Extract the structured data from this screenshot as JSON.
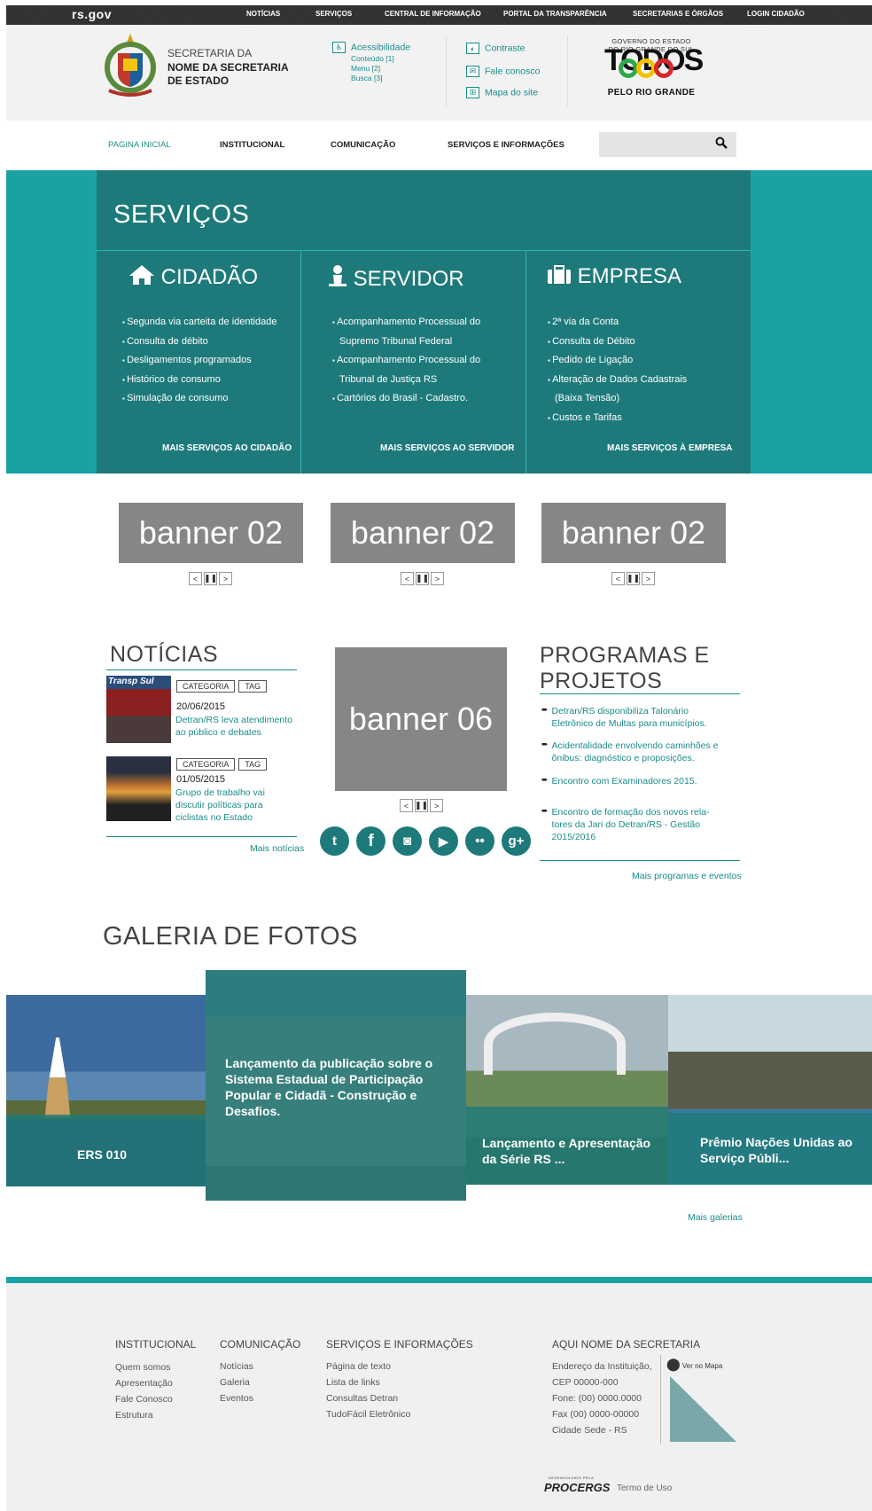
{
  "topbar": {
    "logo": "rs.gov",
    "links": [
      "NOTÍCIAS",
      "SERVIÇOS",
      "CENTRAL DE INFORMAÇÃO",
      "PORTAL DA TRANSPARÊNCIA",
      "SECRETARIAS E ÓRGÃOS",
      "LOGIN CIDADÃO"
    ]
  },
  "header": {
    "org_line1": "SECRETARIA DA",
    "org_line2": "NOME DA SECRETARIA",
    "org_line3": "DE ESTADO",
    "accessibility": "Acessibilidade",
    "shortcuts": [
      "Conteúdo [1]",
      "Menu [2]",
      "Busca [3]"
    ],
    "contrast": "Contraste",
    "contact": "Fale conosco",
    "sitemap": "Mapa do site",
    "gov_line1": "GOVERNO DO ESTADO",
    "gov_line2": "DO RIO GRANDE DO SUL",
    "todos": "TODOS",
    "todos_sub": "PELO RIO GRANDE"
  },
  "nav": {
    "items": [
      "PAGINA INICIAL",
      "INSTITUCIONAL",
      "COMUNICAÇÃO",
      "SERVIÇOS E INFORMAÇÕES"
    ],
    "search_placeholder": ""
  },
  "services": {
    "title": "SERVIÇOS",
    "cidadao": {
      "title": "CIDADÃO",
      "items": [
        "Segunda via carteita de identidade",
        "Consulta de débito",
        "Desligamentos programados",
        "Histórico de consumo",
        "Simulação de consumo"
      ],
      "more": "MAIS SERVIÇOS AO CIDADÃO"
    },
    "servidor": {
      "title": "SERVIDOR",
      "items": [
        "Acompanhamento Processual do",
        "Supremo Tribunal Federal",
        "Acompanhamento Processual do",
        "Tribunal de Justiça RS",
        "Cartórios do Brasil - Cadastro."
      ],
      "more": "MAIS SERVIÇOS AO SERVIDOR"
    },
    "empresa": {
      "title": "EMPRESA",
      "items": [
        "2ª via da Conta",
        "Consulta de Débito",
        "Pedido de Ligação",
        "Alteração de Dados Cadastrais",
        "(Baixa Tensão)",
        "Custos e Tarifas"
      ],
      "more": "MAIS SERVIÇOS À EMPRESA"
    }
  },
  "banners": {
    "label": "banner 02",
    "center": "banner 06"
  },
  "news": {
    "title": "NOTÍCIAS",
    "items": [
      {
        "category": "CATEGORIA",
        "tag": "TAG",
        "date": "20/06/2015",
        "text1": "Detran/RS leva atendimento",
        "text2": "ao público e debates",
        "text3": ""
      },
      {
        "category": "CATEGORIA",
        "tag": "TAG",
        "date": "01/05/2015",
        "text1": "Grupo de trabalho vai",
        "text2": "discutir políticas para",
        "text3": "ciclistas no Estado"
      }
    ],
    "thumb_text": "Transp Sul",
    "more": "Mais notícias"
  },
  "programs": {
    "title1": "PROGRAMAS E",
    "title2": "PROJETOS",
    "items": [
      [
        "Detran/RS disponibiliza Talonário",
        "Eletrônico de Multas para municípios."
      ],
      [
        "Acidentalidade envolvendo caminhões e",
        "ônibus: diagnóstico e proposições."
      ],
      [
        "Encontro com Examinadores 2015."
      ],
      [
        "Encontro de formação dos novos rela-",
        "tores da Jari do Detran/RS - Gestão",
        "2015/2016"
      ]
    ],
    "more": "Mais programas e eventos"
  },
  "social": {
    "icons": [
      "twitter-icon",
      "facebook-icon",
      "instagram-icon",
      "youtube-icon",
      "flickr-icon",
      "google-plus-icon"
    ]
  },
  "gallery": {
    "title": "GALERIA DE FOTOS",
    "items": [
      "ERS 010",
      "Lançamento da publicação sobre o Sistema Estadual de Participação Popular e Cidadã - Construção e Desafios.",
      "Lançamento e Apresentação da Série RS ...",
      "Prêmio Nações Unidas ao Serviço Públi..."
    ],
    "more": "Mais galerias"
  },
  "footer": {
    "institucional": {
      "title": "INSTITUCIONAL",
      "links": [
        "Quem somos",
        "Apresentação",
        "Fale Conosco",
        "Estrutura"
      ]
    },
    "comunicacao": {
      "title": "COMUNICAÇÃO",
      "links": [
        "Notícias",
        "Galeria",
        "Eventos"
      ]
    },
    "servicos": {
      "title": "SERVIÇOS E INFORMAÇÕES",
      "links": [
        "Página de texto",
        "Lista de links",
        "Consultas Detran",
        "TudoFácil Eletrônico"
      ]
    },
    "secretaria": {
      "title": "AQUI NOME DA SECRETARIA",
      "lines": [
        "Endereço da Instituição,",
        "CEP 00000-000",
        "Fone: (00) 0000.0000",
        "Fax (00) 0000-00000",
        "Cidade Sede - RS"
      ]
    },
    "map_link": "Ver no Mapa",
    "dev_label": "DESENVOLVIDO PELA",
    "dev_name": "PROCERGS",
    "terms": "Termo de Uso"
  }
}
